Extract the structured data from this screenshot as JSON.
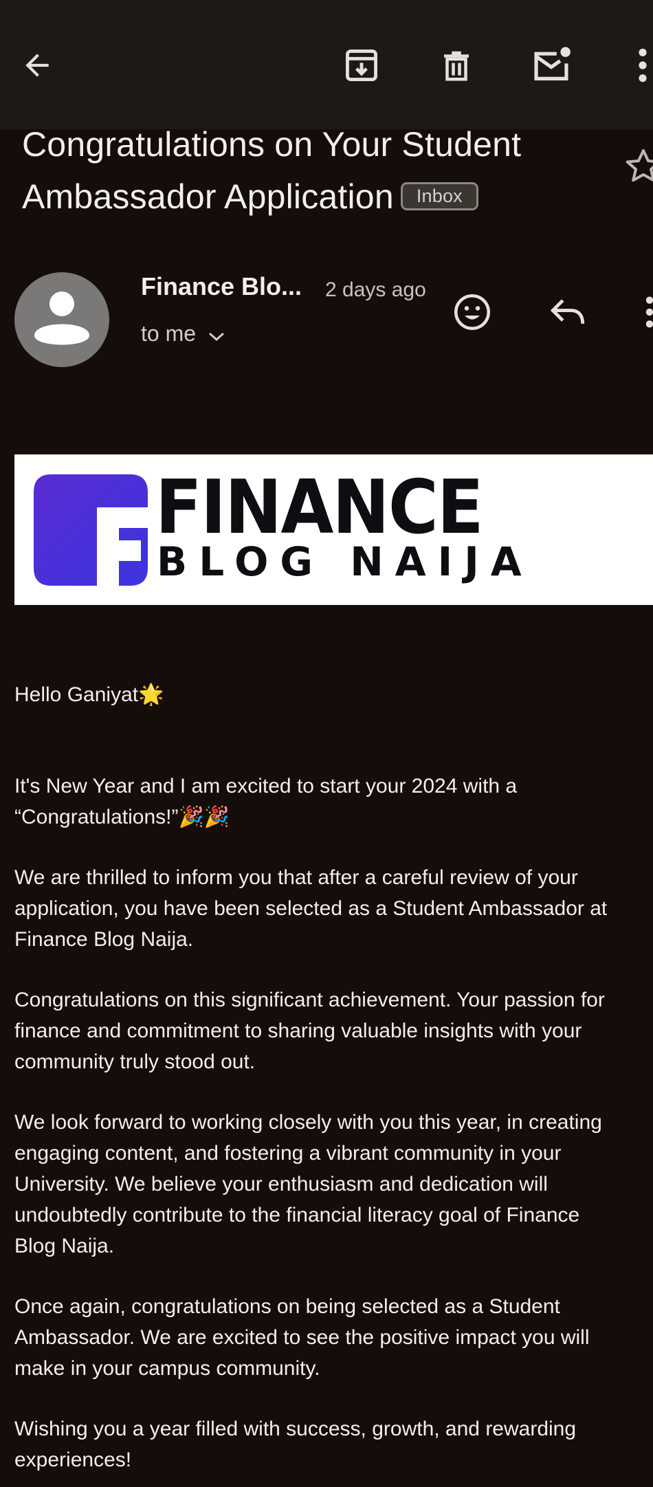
{
  "subject": {
    "line1": "Congratulations on Your Student",
    "line2": "Ambassador Application",
    "label": "Inbox"
  },
  "sender": {
    "name": "Finance Blo...",
    "time": "2 days ago",
    "recipient": "to me"
  },
  "banner": {
    "brand_top": "FINANCE",
    "brand_bottom": "BLOG NAIJA",
    "logo_color": "#4b2fd3"
  },
  "body": {
    "greeting": "Hello Ganiyat🌟",
    "p1_l1": "It's New Year and I am excited to start your 2024 with a",
    "p1_l2": "“Congratulations!”🎉🎉",
    "p2_l1": "We are thrilled to inform you that after a careful review of your",
    "p2_l2": "application, you have been selected as a Student Ambassador at",
    "p2_l3": "Finance Blog Naija.",
    "p3_l1": "Congratulations on this significant achievement. Your passion for",
    "p3_l2": "finance and commitment to sharing valuable insights with your",
    "p3_l3": "community truly stood out.",
    "p4_l1": "We look forward to working closely with you this year, in creating",
    "p4_l2": "engaging content, and fostering a vibrant community in your",
    "p4_l3": "University. We believe your enthusiasm and dedication will",
    "p4_l4": "undoubtedly contribute to the financial literacy goal of Finance",
    "p4_l5": "Blog Naija.",
    "p5_l1": "Once again, congratulations on being selected as a Student",
    "p5_l2": "Ambassador. We are excited to see the positive impact you will",
    "p5_l3": "make in your campus community.",
    "p6_l1": "Wishing you a year filled with success, growth, and rewarding",
    "p6_l2": "experiences!"
  },
  "icons": {
    "back": "arrow-left-icon",
    "archive": "archive-icon",
    "delete": "trash-icon",
    "mark_unread": "mail-unread-icon",
    "more": "more-vert-icon",
    "star": "star-outline-icon",
    "emoji": "emoji-react-icon",
    "reply": "reply-icon"
  },
  "colors": {
    "background": "#150d0a",
    "toolbar": "#1d1915",
    "text": "#f3efec"
  }
}
